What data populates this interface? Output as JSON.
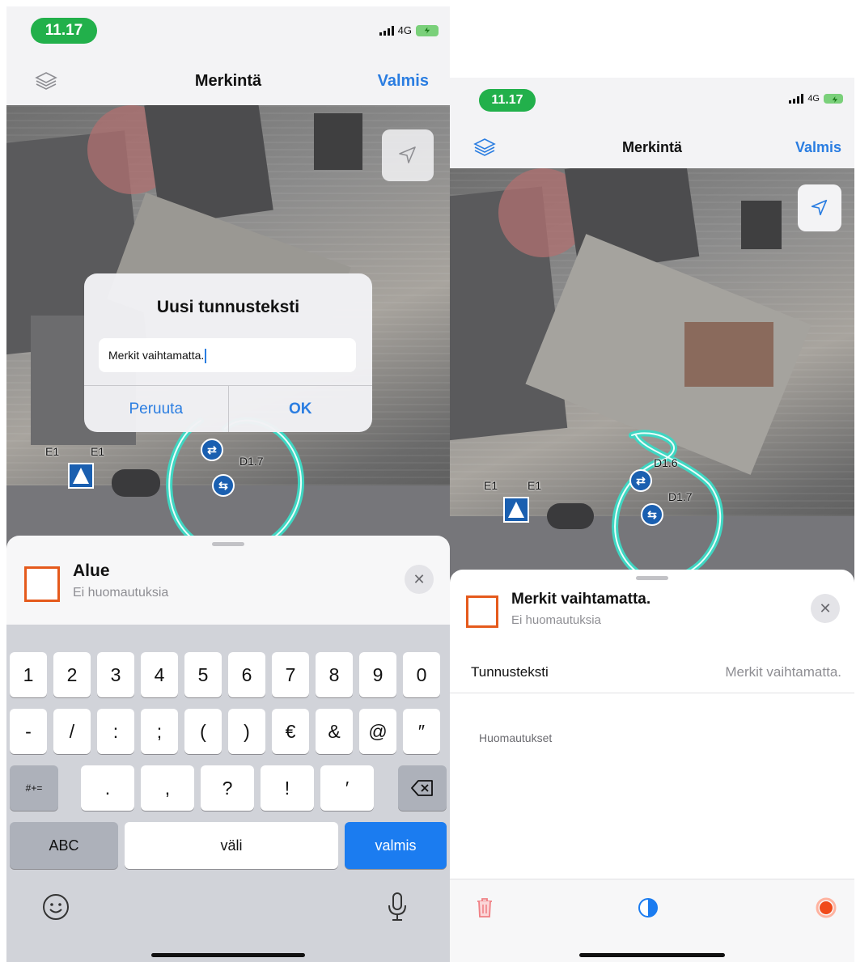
{
  "left": {
    "status": {
      "time": "11.17",
      "network": "4G"
    },
    "nav": {
      "title": "Merkintä",
      "done": "Valmis"
    },
    "map_labels": {
      "e1_a": "E1",
      "e1_b": "E1",
      "d17": "D1.7"
    },
    "dialog": {
      "title": "Uusi tunnusteksti",
      "input_value": "Merkit vaihtamatta.",
      "cancel": "Peruuta",
      "ok": "OK"
    },
    "sheet": {
      "title": "Alue",
      "subtitle": "Ei huomautuksia",
      "close": "✕"
    },
    "keyboard": {
      "row1": [
        "1",
        "2",
        "3",
        "4",
        "5",
        "6",
        "7",
        "8",
        "9",
        "0"
      ],
      "row2": [
        "-",
        "/",
        ":",
        ";",
        "(",
        ")",
        "€",
        "&",
        "@",
        "″"
      ],
      "row3_mode": "#+=",
      "row3": [
        ".",
        ",",
        "?",
        "!",
        "′"
      ],
      "abc": "ABC",
      "space": "väli",
      "return": "valmis"
    }
  },
  "right": {
    "status": {
      "time": "11.17",
      "network": "4G"
    },
    "nav": {
      "title": "Merkintä",
      "done": "Valmis"
    },
    "map_labels": {
      "e1_a": "E1",
      "e1_b": "E1",
      "d16": "D1.6",
      "d17": "D1.7"
    },
    "sheet": {
      "title": "Merkit vaihtamatta.",
      "subtitle": "Ei huomautuksia",
      "close": "✕"
    },
    "field": {
      "label": "Tunnusteksti",
      "value": "Merkit vaihtamatta."
    },
    "notes_label": "Huomautukset"
  },
  "colors": {
    "accent": "#2a7de1",
    "status_green": "#22b04b",
    "area_orange": "#e55a1c",
    "highlight_orange": "#d46a1e",
    "highlight_blue": "#1e58a8",
    "route_teal": "#3fd6c2"
  },
  "icons": [
    "layers-icon",
    "location-arrow-icon",
    "close-icon",
    "delete-icon",
    "half-circle-icon",
    "record-dot-icon",
    "emoji-icon",
    "microphone-icon",
    "backspace-icon"
  ]
}
